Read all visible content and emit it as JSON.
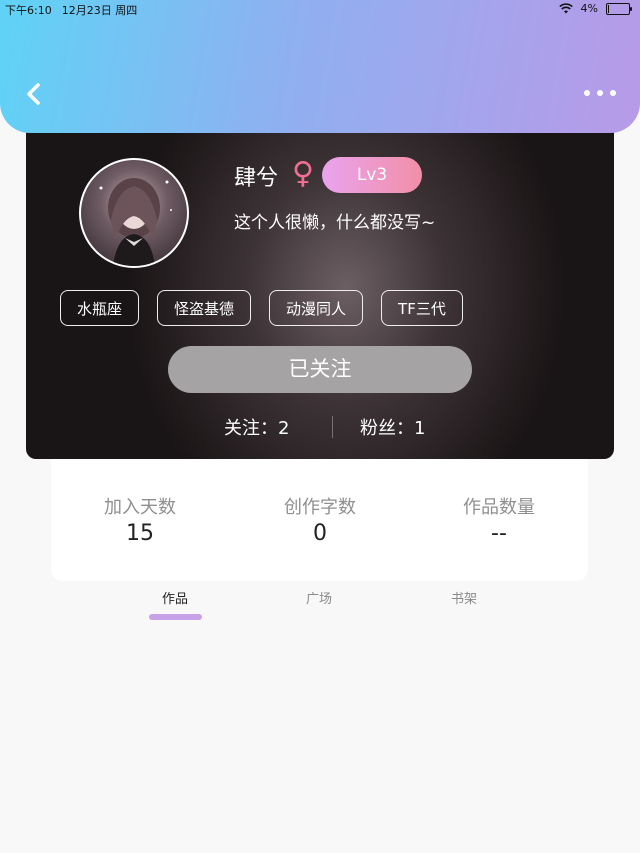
{
  "status_bar": {
    "time": "下午6:10",
    "date": "12月23日 周四",
    "battery_percent": "4%",
    "battery_level": 0.04
  },
  "header": {
    "back_icon": "chevron-left-icon",
    "more_icon": "more-dots-icon"
  },
  "profile": {
    "username": "肆兮",
    "gender_symbol": "♀",
    "level": "Lv3",
    "bio": "这个人很懒，什么都没写~",
    "tags": [
      "水瓶座",
      "怪盗基德",
      "动漫同人",
      "TF三代"
    ],
    "follow_button_label": "已关注",
    "following_text": "关注：2",
    "fans_text": "粉丝：1"
  },
  "stats": [
    {
      "label": "加入天数",
      "value": "15"
    },
    {
      "label": "创作字数",
      "value": "0"
    },
    {
      "label": "作品数量",
      "value": "--"
    }
  ],
  "tabs": [
    {
      "label": "作品",
      "active": true
    },
    {
      "label": "广场",
      "active": false
    },
    {
      "label": "书架",
      "active": false
    }
  ],
  "colors": {
    "header_gradient_start": "#5fd3f6",
    "header_gradient_end": "#b89ae8",
    "level_badge_start": "#e9a3ee",
    "level_badge_end": "#f28fa7",
    "gender_color": "#f06f93",
    "tab_indicator": "#c8a2e9"
  }
}
